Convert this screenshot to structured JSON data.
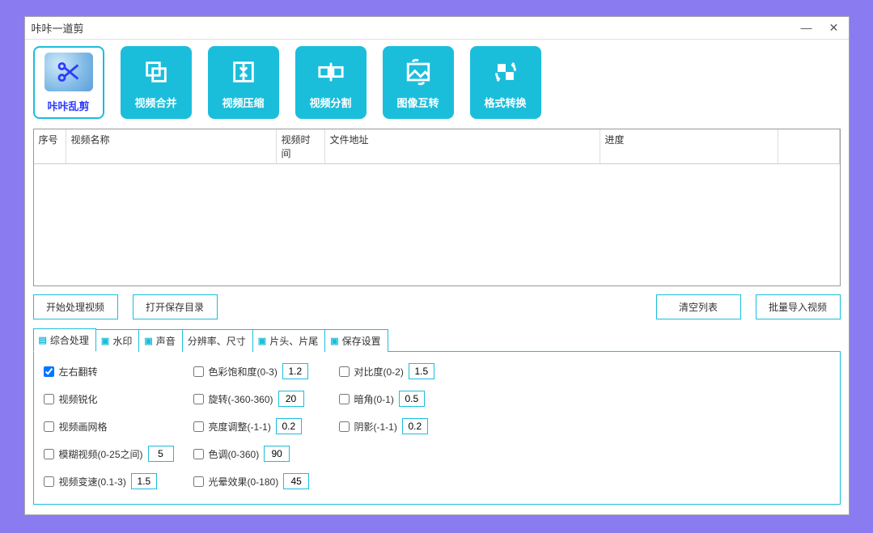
{
  "titlebar": {
    "title": "咔咔一道剪"
  },
  "toolbar": {
    "items": [
      {
        "label": "咔咔乱剪",
        "selected": true,
        "icon": "scissors"
      },
      {
        "label": "视频合并",
        "selected": false,
        "icon": "merge"
      },
      {
        "label": "视频压缩",
        "selected": false,
        "icon": "compress"
      },
      {
        "label": "视频分割",
        "selected": false,
        "icon": "split"
      },
      {
        "label": "图像互转",
        "selected": false,
        "icon": "image"
      },
      {
        "label": "格式转换",
        "selected": false,
        "icon": "convert"
      }
    ]
  },
  "table": {
    "headers": {
      "seq": "序号",
      "name": "视频名称",
      "time": "视频时间",
      "addr": "文件地址",
      "prog": "进度"
    }
  },
  "actions": {
    "start": "开始处理视频",
    "open_dir": "打开保存目录",
    "clear": "清空列表",
    "import": "批量导入视频"
  },
  "tabs": [
    {
      "label": "综合处理",
      "active": true
    },
    {
      "label": "水印",
      "active": false
    },
    {
      "label": "声音",
      "active": false
    },
    {
      "label": "分辨率、尺寸",
      "active": false
    },
    {
      "label": "片头、片尾",
      "active": false
    },
    {
      "label": "保存设置",
      "active": false
    }
  ],
  "panel": {
    "col1": [
      {
        "label": "左右翻转",
        "checked": true,
        "value": null
      },
      {
        "label": "视频锐化",
        "checked": false,
        "value": null
      },
      {
        "label": "视频画网格",
        "checked": false,
        "value": null
      },
      {
        "label": "模糊视频(0-25之间)",
        "checked": false,
        "value": "5"
      },
      {
        "label": "视频变速(0.1-3)",
        "checked": false,
        "value": "1.5"
      }
    ],
    "col2": [
      {
        "label": "色彩饱和度(0-3)",
        "checked": false,
        "value": "1.2"
      },
      {
        "label": "旋转(-360-360)",
        "checked": false,
        "value": "20"
      },
      {
        "label": "亮度调整(-1-1)",
        "checked": false,
        "value": "0.2"
      },
      {
        "label": "色调(0-360)",
        "checked": false,
        "value": "90"
      },
      {
        "label": "光晕效果(0-180)",
        "checked": false,
        "value": "45"
      }
    ],
    "col3": [
      {
        "label": "对比度(0-2)",
        "checked": false,
        "value": "1.5"
      },
      {
        "label": "暗角(0-1)",
        "checked": false,
        "value": "0.5"
      },
      {
        "label": "阴影(-1-1)",
        "checked": false,
        "value": "0.2"
      }
    ]
  }
}
